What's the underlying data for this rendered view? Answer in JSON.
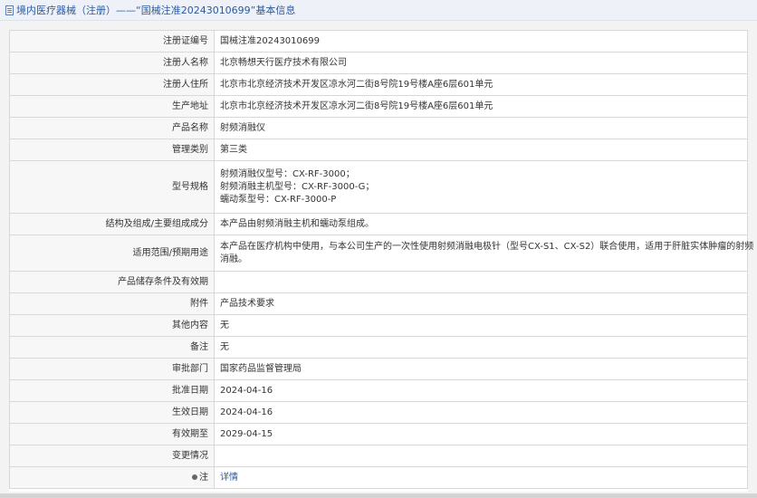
{
  "header": {
    "title": "境内医疗器械（注册）——“国械注准20243010699”基本信息"
  },
  "rows": {
    "reg_no": {
      "label": "注册证编号",
      "value": "国械注准20243010699"
    },
    "registrant": {
      "label": "注册人名称",
      "value": "北京畅想天行医疗技术有限公司"
    },
    "registrant_addr": {
      "label": "注册人住所",
      "value": "北京市北京经济技术开发区凉水河二街8号院19号楼A座6层601单元"
    },
    "production_addr": {
      "label": "生产地址",
      "value": "北京市北京经济技术开发区凉水河二街8号院19号楼A座6层601单元"
    },
    "product_name": {
      "label": "产品名称",
      "value": "射频消融仪"
    },
    "category": {
      "label": "管理类别",
      "value": "第三类"
    },
    "models": {
      "label": "型号规格",
      "lines": [
        "射频消融仪型号：CX-RF-3000；",
        "射频消融主机型号：CX-RF-3000-G；",
        "蠕动泵型号：CX-RF-3000-P"
      ]
    },
    "structure": {
      "label": "结构及组成/主要组成成分",
      "value": "本产品由射频消融主机和蠕动泵组成。"
    },
    "usage": {
      "label": "适用范围/预期用途",
      "lines": [
        "本产品在医疗机构中使用，与本公司生产的一次性使用射频消融电极针（型号CX-S1、CX-S2）联合使用，适用于肝脏实体肿瘤的射频",
        "消融。"
      ]
    },
    "storage": {
      "label": "产品储存条件及有效期",
      "value": ""
    },
    "attachment": {
      "label": "附件",
      "value": "产品技术要求"
    },
    "other": {
      "label": "其他内容",
      "value": "无"
    },
    "remark": {
      "label": "备注",
      "value": "无"
    },
    "dept": {
      "label": "审批部门",
      "value": "国家药品监督管理局"
    },
    "approve_date": {
      "label": "批准日期",
      "value": "2024-04-16"
    },
    "effective_date": {
      "label": "生效日期",
      "value": "2024-04-16"
    },
    "valid_until": {
      "label": "有效期至",
      "value": "2029-04-15"
    },
    "changes": {
      "label": "变更情况",
      "value": ""
    },
    "note": {
      "label": "注",
      "value": "详情"
    }
  }
}
